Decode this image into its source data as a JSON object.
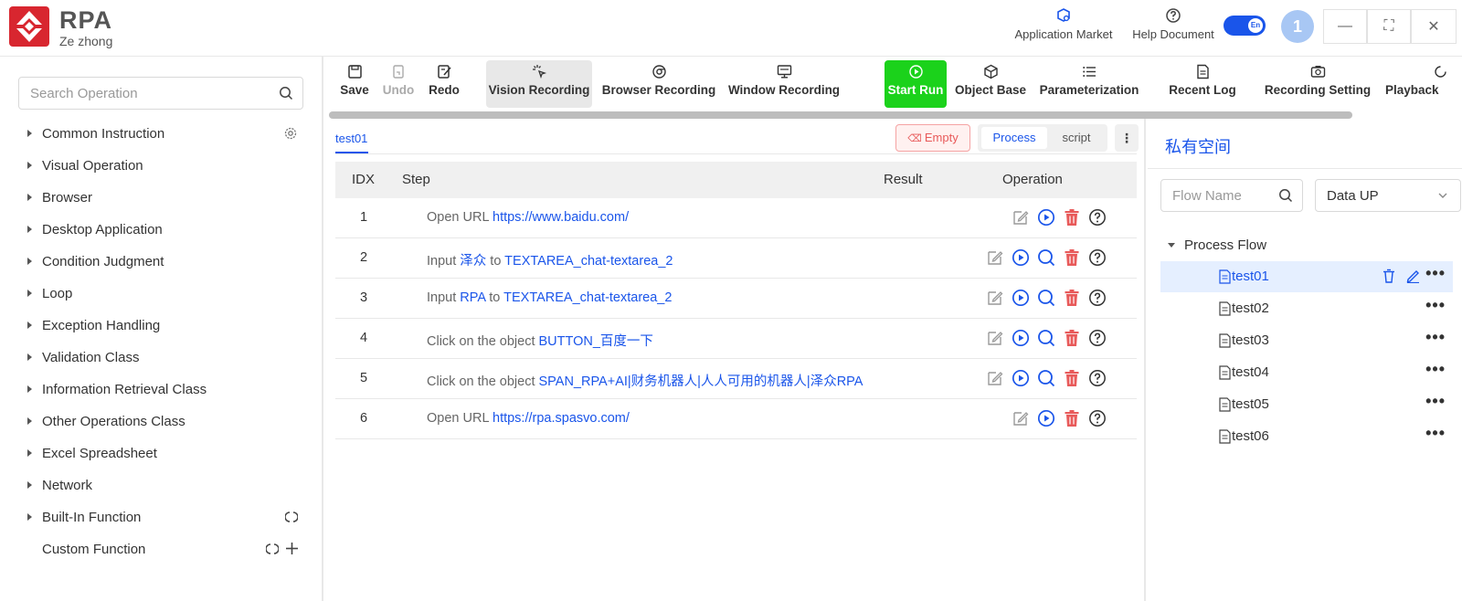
{
  "header": {
    "logo_title": "RPA",
    "logo_sub": "Ze zhong",
    "app_market": "Application Market",
    "help_document": "Help Document",
    "lang_toggle": "En",
    "avatar_text": "1",
    "minimize": "—",
    "maximize": "⛶",
    "close": "✕"
  },
  "sidebar": {
    "search_placeholder": "Search Operation",
    "items": [
      {
        "label": "Common Instruction"
      },
      {
        "label": "Visual Operation"
      },
      {
        "label": "Browser"
      },
      {
        "label": "Desktop Application"
      },
      {
        "label": "Condition Judgment"
      },
      {
        "label": "Loop"
      },
      {
        "label": "Exception Handling"
      },
      {
        "label": "Validation Class"
      },
      {
        "label": "Information Retrieval Class"
      },
      {
        "label": "Other Operations Class"
      },
      {
        "label": "Excel Spreadsheet"
      },
      {
        "label": "Network"
      },
      {
        "label": "Built-In Function"
      },
      {
        "label": "Custom Function"
      }
    ]
  },
  "toolbar": {
    "save": "Save",
    "undo": "Undo",
    "redo": "Redo",
    "vision_recording": "Vision Recording",
    "browser_recording": "Browser Recording",
    "window_recording": "Window Recording",
    "start_run": "Start Run",
    "object_base": "Object Base",
    "parameterization": "Parameterization",
    "recent_log": "Recent Log",
    "recording_setting": "Recording Setting",
    "playback": "Playback"
  },
  "editor": {
    "tab": "test01",
    "empty_button": "Empty",
    "seg_process": "Process",
    "seg_script": "script",
    "more": "⋮",
    "columns": {
      "idx": "IDX",
      "step": "Step",
      "result": "Result",
      "operation": "Operation"
    },
    "rows": [
      {
        "idx": "1",
        "prefix": "Open URL ",
        "link1": "https://www.baidu.com/",
        "mid": "",
        "link2": ""
      },
      {
        "idx": "2",
        "prefix": "Input ",
        "link1": "泽众",
        "mid": " to ",
        "link2": "TEXTAREA_chat-textarea_2"
      },
      {
        "idx": "3",
        "prefix": "Input ",
        "link1": "RPA",
        "mid": " to ",
        "link2": "TEXTAREA_chat-textarea_2"
      },
      {
        "idx": "4",
        "prefix": "Click on the object ",
        "link1": "BUTTON_百度一下",
        "mid": "",
        "link2": ""
      },
      {
        "idx": "5",
        "prefix": "Click on the object ",
        "link1": "SPAN_RPA+AI|财务机器人|人人可用的机器人|泽众RPA",
        "mid": "",
        "link2": ""
      },
      {
        "idx": "6",
        "prefix": "Open URL ",
        "link1": "https://rpa.spasvo.com/",
        "mid": "",
        "link2": ""
      }
    ]
  },
  "right_panel": {
    "title": "私有空间",
    "flow_search_placeholder": "Flow Name",
    "sort_value": "Data UP",
    "process_flow": "Process Flow",
    "flows": [
      {
        "name": "test01"
      },
      {
        "name": "test02"
      },
      {
        "name": "test03"
      },
      {
        "name": "test04"
      },
      {
        "name": "test05"
      },
      {
        "name": "test06"
      }
    ],
    "dots": "•••"
  },
  "colors": {
    "accent": "#1a55ea",
    "run_green": "#1bd21b",
    "danger": "#e85a5a",
    "logo_red": "#d8262f"
  }
}
